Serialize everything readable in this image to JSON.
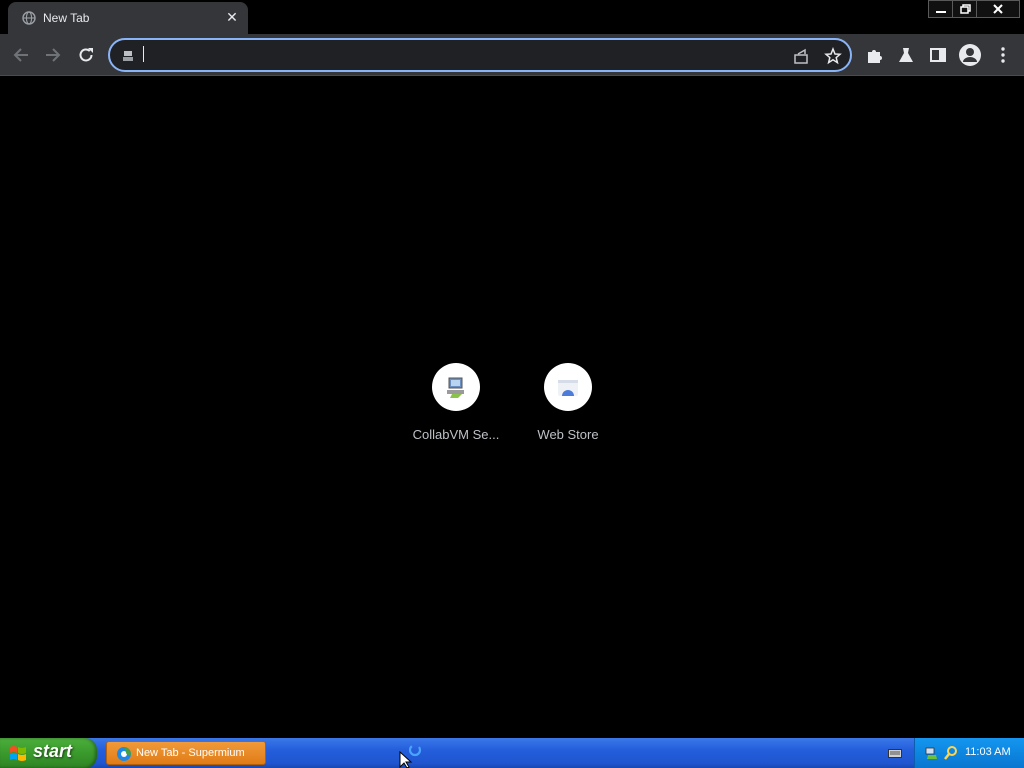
{
  "browser": {
    "tab": {
      "title": "New Tab"
    },
    "omnibox": {
      "value": "",
      "placeholder": ""
    }
  },
  "ntp": {
    "shortcuts": [
      {
        "label": "CollabVM Se...",
        "icon": "collabvm-icon"
      },
      {
        "label": "Web Store",
        "icon": "web-store-icon"
      }
    ]
  },
  "taskbar": {
    "start_label": "start",
    "task": {
      "label": "New Tab - Supermium"
    },
    "clock": "11:03 AM"
  },
  "colors": {
    "accent": "#8ab4f8",
    "toolbar": "#35363a",
    "taskbar": "#245edb",
    "start": "#3a9a2c",
    "task": "#e07c16",
    "tray": "#0d86e0"
  }
}
